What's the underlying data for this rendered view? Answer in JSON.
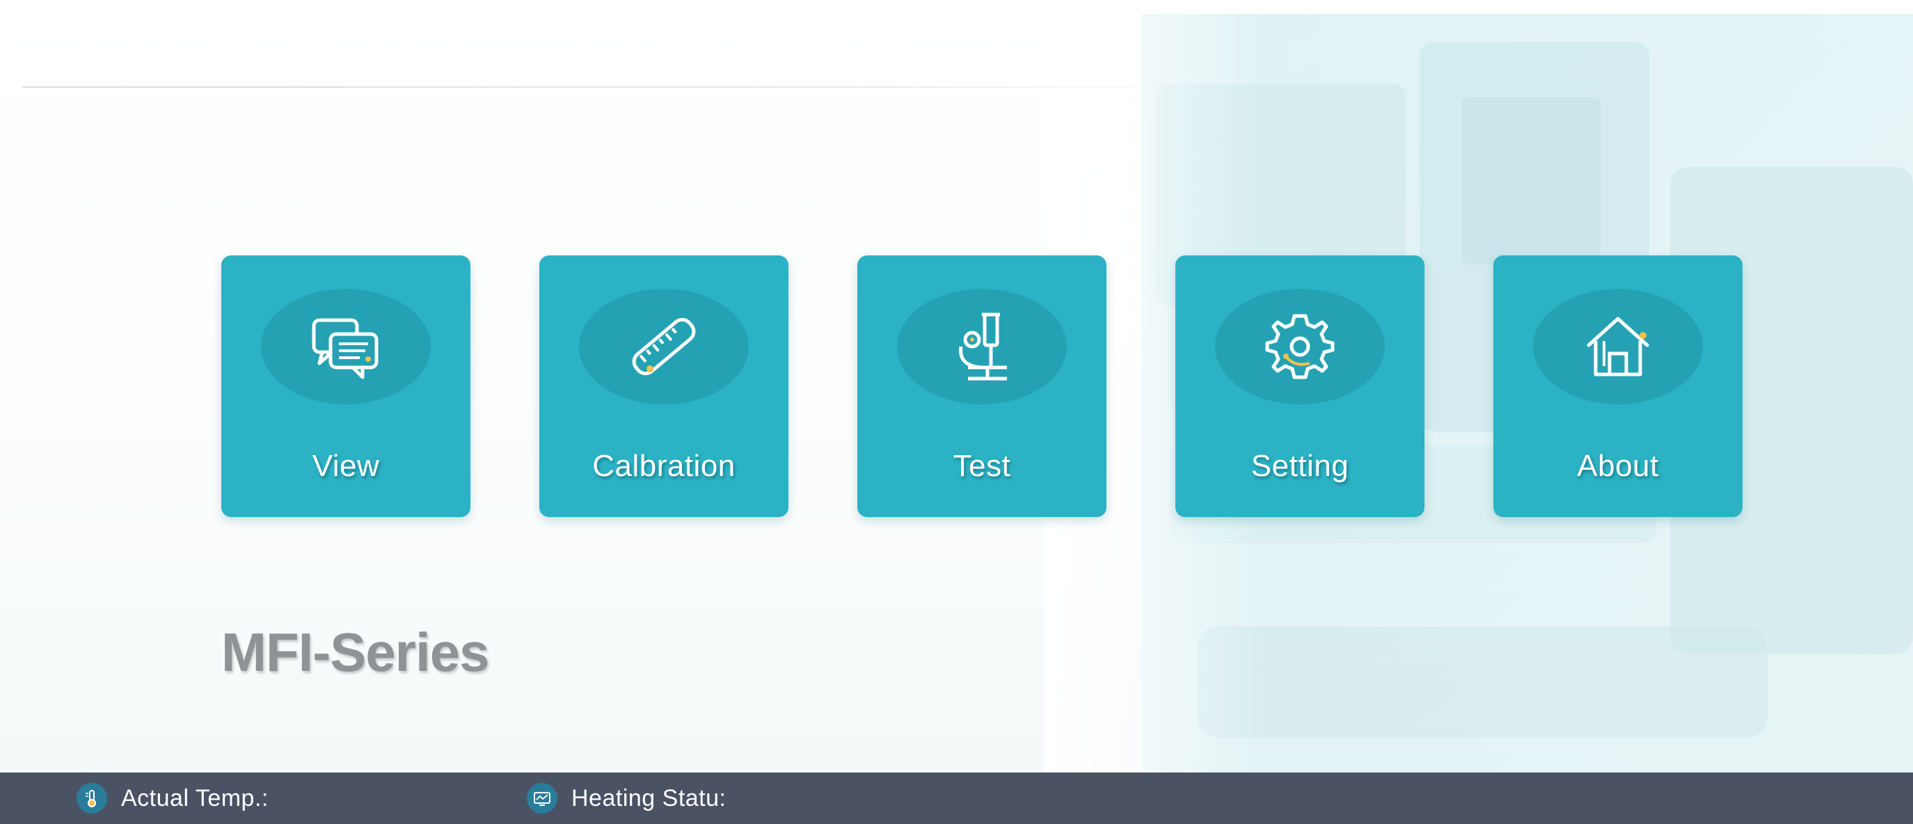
{
  "app": {
    "brand_title": "MFI-Series"
  },
  "menu": {
    "tiles": [
      {
        "label": "View",
        "icon": "chat-bubbles-icon"
      },
      {
        "label": "Calbration",
        "icon": "ruler-icon"
      },
      {
        "label": "Test",
        "icon": "microscope-icon"
      },
      {
        "label": "Setting",
        "icon": "gear-icon"
      },
      {
        "label": "About",
        "icon": "house-icon"
      }
    ]
  },
  "status_bar": {
    "temp_label": "Actual Temp.:",
    "temp_icon": "thermometer-icon",
    "heating_label": "Heating Statu:",
    "heating_icon": "monitor-icon"
  },
  "colors": {
    "tile_bg": "#2bb2c4",
    "tile_icon_circle": "#24a2b3",
    "status_bar_bg": "#4a5264",
    "brand_text": "#8e9395",
    "accent_yellow": "#f2c14e"
  }
}
